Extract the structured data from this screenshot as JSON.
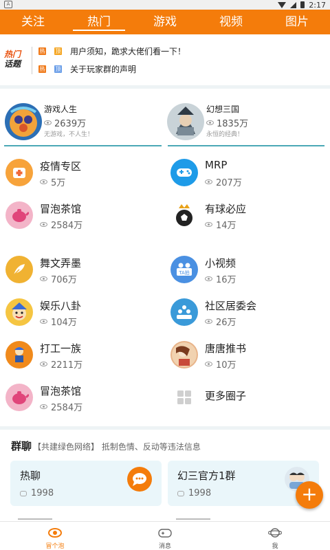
{
  "colors": {
    "accent": "#f47c0b",
    "divider_teal": "#4aa8b5",
    "card_bg": "#eaf6fa"
  },
  "status_bar": {
    "time": "2:17"
  },
  "top_tabs": [
    {
      "label": "关注",
      "active": false
    },
    {
      "label": "热门",
      "active": true
    },
    {
      "label": "游戏",
      "active": false
    },
    {
      "label": "视频",
      "active": false
    },
    {
      "label": "图片",
      "active": false
    }
  ],
  "hot_topics": {
    "logo_line1": "热门",
    "logo_line2": "话题",
    "items": [
      {
        "tag1": "热",
        "tag2": "顶",
        "tag1_color": "#f07a1a",
        "tag2_color": "#f5a623",
        "text": "用户须知，跪求大佬们看一下！"
      },
      {
        "tag1": "热",
        "tag2": "顶",
        "tag1_color": "#f07a1a",
        "tag2_color": "#6a9ee8",
        "text": "关于玩家群的声明"
      }
    ]
  },
  "featured": [
    {
      "name": "游戏人生",
      "views": "2639万",
      "desc": "无游戏，不人生！",
      "icon": "game-life-avatar"
    },
    {
      "name": "幻想三国",
      "views": "1835万",
      "desc": "永恒的经典！",
      "icon": "three-kingdoms-avatar"
    }
  ],
  "circles": [
    {
      "name": "疫情专区",
      "views": "5万",
      "icon": "medical-icon",
      "color": "#f7a33b"
    },
    {
      "name": "MRP",
      "views": "207万",
      "icon": "gamepad-icon",
      "color": "#1e9be8"
    },
    {
      "name": "冒泡茶馆",
      "views": "2584万",
      "icon": "teapot-icon",
      "color": "#f3b4c8"
    },
    {
      "name": "有球必应",
      "views": "14万",
      "icon": "soccer-ball-icon",
      "color": "#ffffff"
    },
    {
      "name": "舞文弄墨",
      "views": "706万",
      "icon": "quill-icon",
      "color": "#f0b232"
    },
    {
      "name": "小视频",
      "views": "16万",
      "icon": "camera-icon",
      "color": "#4a90e2"
    },
    {
      "name": "娱乐八卦",
      "views": "104万",
      "icon": "jester-icon",
      "color": "#f5c542"
    },
    {
      "name": "社区居委会",
      "views": "26万",
      "icon": "community-icon",
      "color": "#3a9ad9"
    },
    {
      "name": "打工一族",
      "views": "2211万",
      "icon": "worker-icon",
      "color": "#f08a1c"
    },
    {
      "name": "唐唐推书",
      "views": "10万",
      "icon": "book-avatar-icon",
      "color": "#e8b48a"
    },
    {
      "name": "冒泡茶馆",
      "views": "2584万",
      "icon": "teapot-icon",
      "color": "#f3b4c8"
    },
    {
      "name": "更多圈子",
      "views": "",
      "icon": "more-grid-icon",
      "color": "#ffffff"
    }
  ],
  "group_chat": {
    "title": "群聊",
    "subtitle": "【共建绿色网络】 抵制色情、反动等违法信息",
    "cards": [
      {
        "name": "热聊",
        "count": "1998",
        "icon": "chat-bubble-icon"
      },
      {
        "name": "幻三官方1群",
        "count": "1998",
        "icon": "group-avatar-icon"
      }
    ]
  },
  "fab": {
    "label": "+"
  },
  "bottom_nav": [
    {
      "label": "冒个泡",
      "icon": "eye-icon",
      "active": true
    },
    {
      "label": "消息",
      "icon": "gamepad-outline-icon",
      "active": false
    },
    {
      "label": "我",
      "icon": "planet-icon",
      "active": false
    }
  ]
}
